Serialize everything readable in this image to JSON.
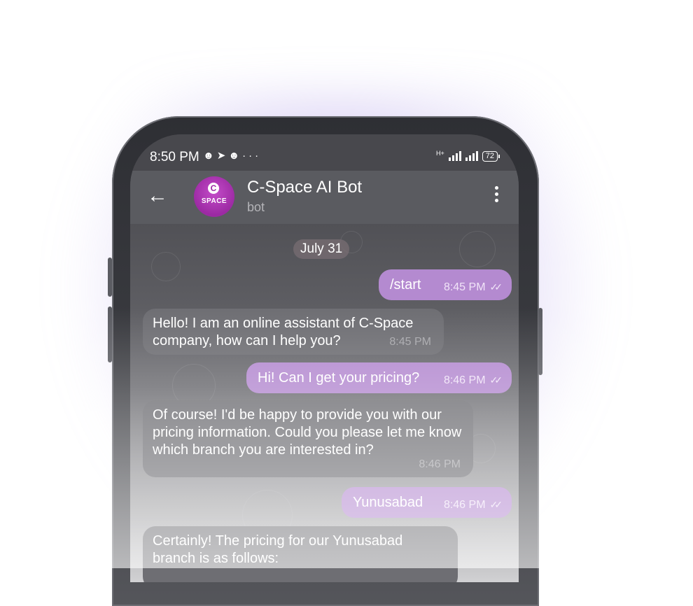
{
  "status_bar": {
    "time": "8:50 PM",
    "left_icons": [
      "discord-icon",
      "telegram-icon",
      "discord-icon",
      "more-dots-icon"
    ],
    "network_label": "H+",
    "battery": "72"
  },
  "chat_header": {
    "back_icon": "arrow-left-icon",
    "avatar_text": "SPACE",
    "avatar_letter": "C",
    "title": "C-Space AI Bot",
    "subtitle": "bot",
    "menu_icon": "vertical-dots-icon"
  },
  "date_separator": "July 31",
  "messages": [
    {
      "direction": "out",
      "text": "/start",
      "time": "8:45 PM",
      "read": true
    },
    {
      "direction": "in",
      "text": "Hello! I am an online assistant of C-Space company, how can I help you?",
      "time": "8:45 PM"
    },
    {
      "direction": "out",
      "text": "Hi! Can I get your pricing?",
      "time": "8:46 PM",
      "read": true
    },
    {
      "direction": "in",
      "text": "Of course! I'd be happy to provide you with our pricing information. Could you please let me know which branch you are interested in?",
      "time": "8:46 PM"
    },
    {
      "direction": "out",
      "text": "Yunusabad",
      "time": "8:46 PM",
      "read": true
    },
    {
      "direction": "in",
      "text": "Certainly! The pricing for our Yunusabad branch is as follows:",
      "time": ""
    }
  ],
  "colors": {
    "outgoing_bubble": "#b48ad0",
    "incoming_bubble": "#6e6e73",
    "avatar": "#9c2aa3",
    "glow": "#9678dc"
  }
}
